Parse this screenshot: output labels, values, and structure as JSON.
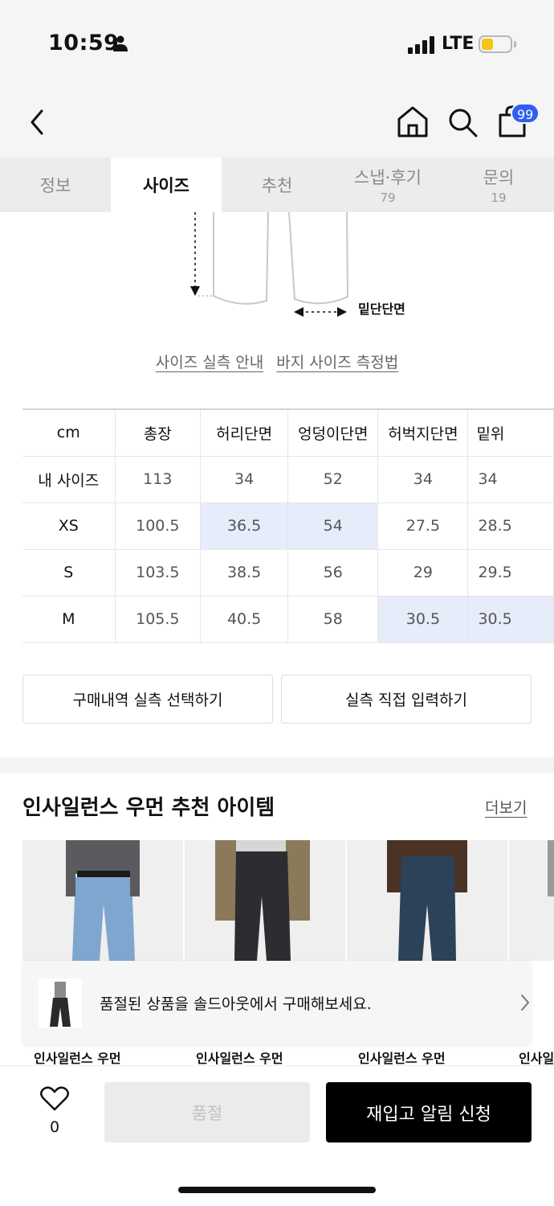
{
  "status_bar": {
    "time": "10:59",
    "network": "LTE"
  },
  "nav": {
    "cart_count": "99"
  },
  "tabs": [
    {
      "label": "정보",
      "count": ""
    },
    {
      "label": "사이즈",
      "count": ""
    },
    {
      "label": "추천",
      "count": ""
    },
    {
      "label": "스냅·후기",
      "count": "79"
    },
    {
      "label": "문의",
      "count": "19"
    }
  ],
  "diagram": {
    "label": "밑단단면"
  },
  "guide_links": {
    "measure_guide": "사이즈 실측 안내",
    "pants_method": "바지 사이즈 측정법"
  },
  "size_table": {
    "headers": [
      "cm",
      "총장",
      "허리단면",
      "엉덩이단면",
      "허벅지단면",
      "밑위"
    ],
    "rows": [
      {
        "label": "내 사이즈",
        "values": [
          "113",
          "34",
          "52",
          "34",
          "34"
        ]
      },
      {
        "label": "XS",
        "values": [
          "100.5",
          "36.5",
          "54",
          "27.5",
          "28.5"
        ]
      },
      {
        "label": "S",
        "values": [
          "103.5",
          "38.5",
          "56",
          "29",
          "29.5"
        ]
      },
      {
        "label": "M",
        "values": [
          "105.5",
          "40.5",
          "58",
          "30.5",
          "30.5"
        ]
      }
    ],
    "highlight_color": "#e7ecfb"
  },
  "actions": {
    "select_history": "구매내역 실측 선택하기",
    "direct_input": "실측 직접 입력하기"
  },
  "recommendations": {
    "title": "인사일런스 우먼 추천 아이템",
    "more": "더보기",
    "items": [
      {
        "name": "인사일런스 우먼"
      },
      {
        "name": "인사일런스 우먼"
      },
      {
        "name": "인사일런스 우먼"
      },
      {
        "name": "인사일런스 우먼"
      }
    ]
  },
  "toast": {
    "text": "품절된 상품을 솔드아웃에서 구매해보세요."
  },
  "bottom_bar": {
    "like_count": "0",
    "soldout_label": "품절",
    "restock_label": "재입고 알림 신청"
  },
  "colors": {
    "accent": "#2f5ef0",
    "highlight": "#e7ecfb",
    "primary_button": "#000000"
  }
}
